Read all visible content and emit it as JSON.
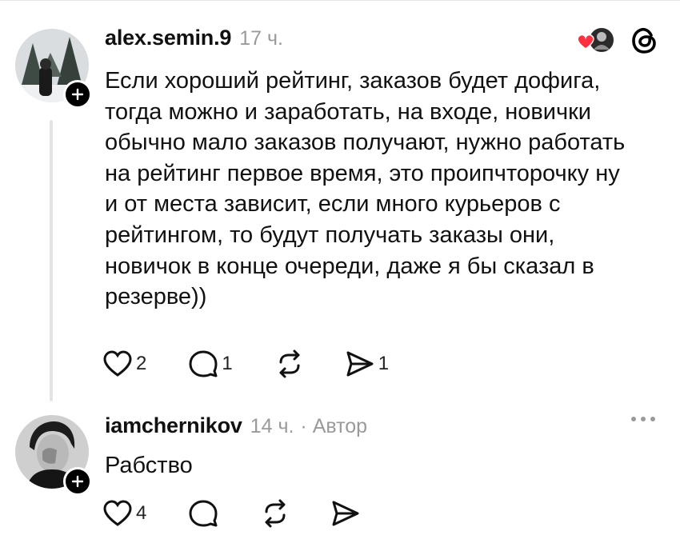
{
  "comments": [
    {
      "username": "alex.semin.9",
      "time": "17 ч.",
      "text": "Если хороший рейтинг, заказов будет дофига,\nтогда можно и заработать, на входе, новички\nобычно мало заказов получают, нужно работать\nна рейтинг первое время, это проипчторочку ну\nи от места зависит, если много курьеров с\nрейтингом, то будут получать заказы они,\nновичок в конце очереди, даже я бы сказал в\nрезерве))",
      "likes": "2",
      "replies": "1",
      "reposts": "",
      "shares": "1"
    },
    {
      "username": "iamchernikov",
      "time": "14 ч.",
      "author_badge": "· Автор",
      "text": "Рабство",
      "likes": "4",
      "replies": "",
      "reposts": "",
      "shares": ""
    }
  ],
  "icons": {
    "like": "heart-outline-icon",
    "reply": "speech-bubble-icon",
    "repost": "repost-arrows-icon",
    "share": "send-icon",
    "follow": "plus-icon",
    "app": "threads-logo-icon",
    "more": "more-dots-icon"
  },
  "colors": {
    "accent_like": "#ff3040",
    "muted": "#9a9a9a"
  }
}
